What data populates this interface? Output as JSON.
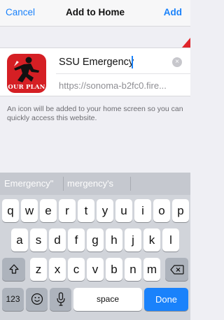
{
  "navbar": {
    "cancel_label": "Cancel",
    "title": "Add to Home",
    "add_label": "Add"
  },
  "card": {
    "icon_text": "OUR PLAN",
    "name_value": "SSU Emergency",
    "url": "https://sonoma-b2fc0.fire..."
  },
  "info": "An icon will be added to your home screen so you can quickly access this website.",
  "keyboard": {
    "predictions": [
      "Emergency\"",
      "mergency's"
    ],
    "row1": [
      "q",
      "w",
      "e",
      "r",
      "t",
      "y",
      "u",
      "i",
      "o",
      "p"
    ],
    "row2": [
      "a",
      "s",
      "d",
      "f",
      "g",
      "h",
      "j",
      "k",
      "l"
    ],
    "row3": [
      "z",
      "x",
      "c",
      "v",
      "b",
      "n",
      "m"
    ],
    "numbers_label": "123",
    "space_label": "space",
    "done_label": "Done",
    "shift_icon": "shift-icon",
    "delete_icon": "delete-icon",
    "emoji_icon": "emoji-icon",
    "mic_icon": "microphone-icon"
  },
  "colors": {
    "accent": "#1a82fb",
    "icon_bg": "#d51f24"
  }
}
